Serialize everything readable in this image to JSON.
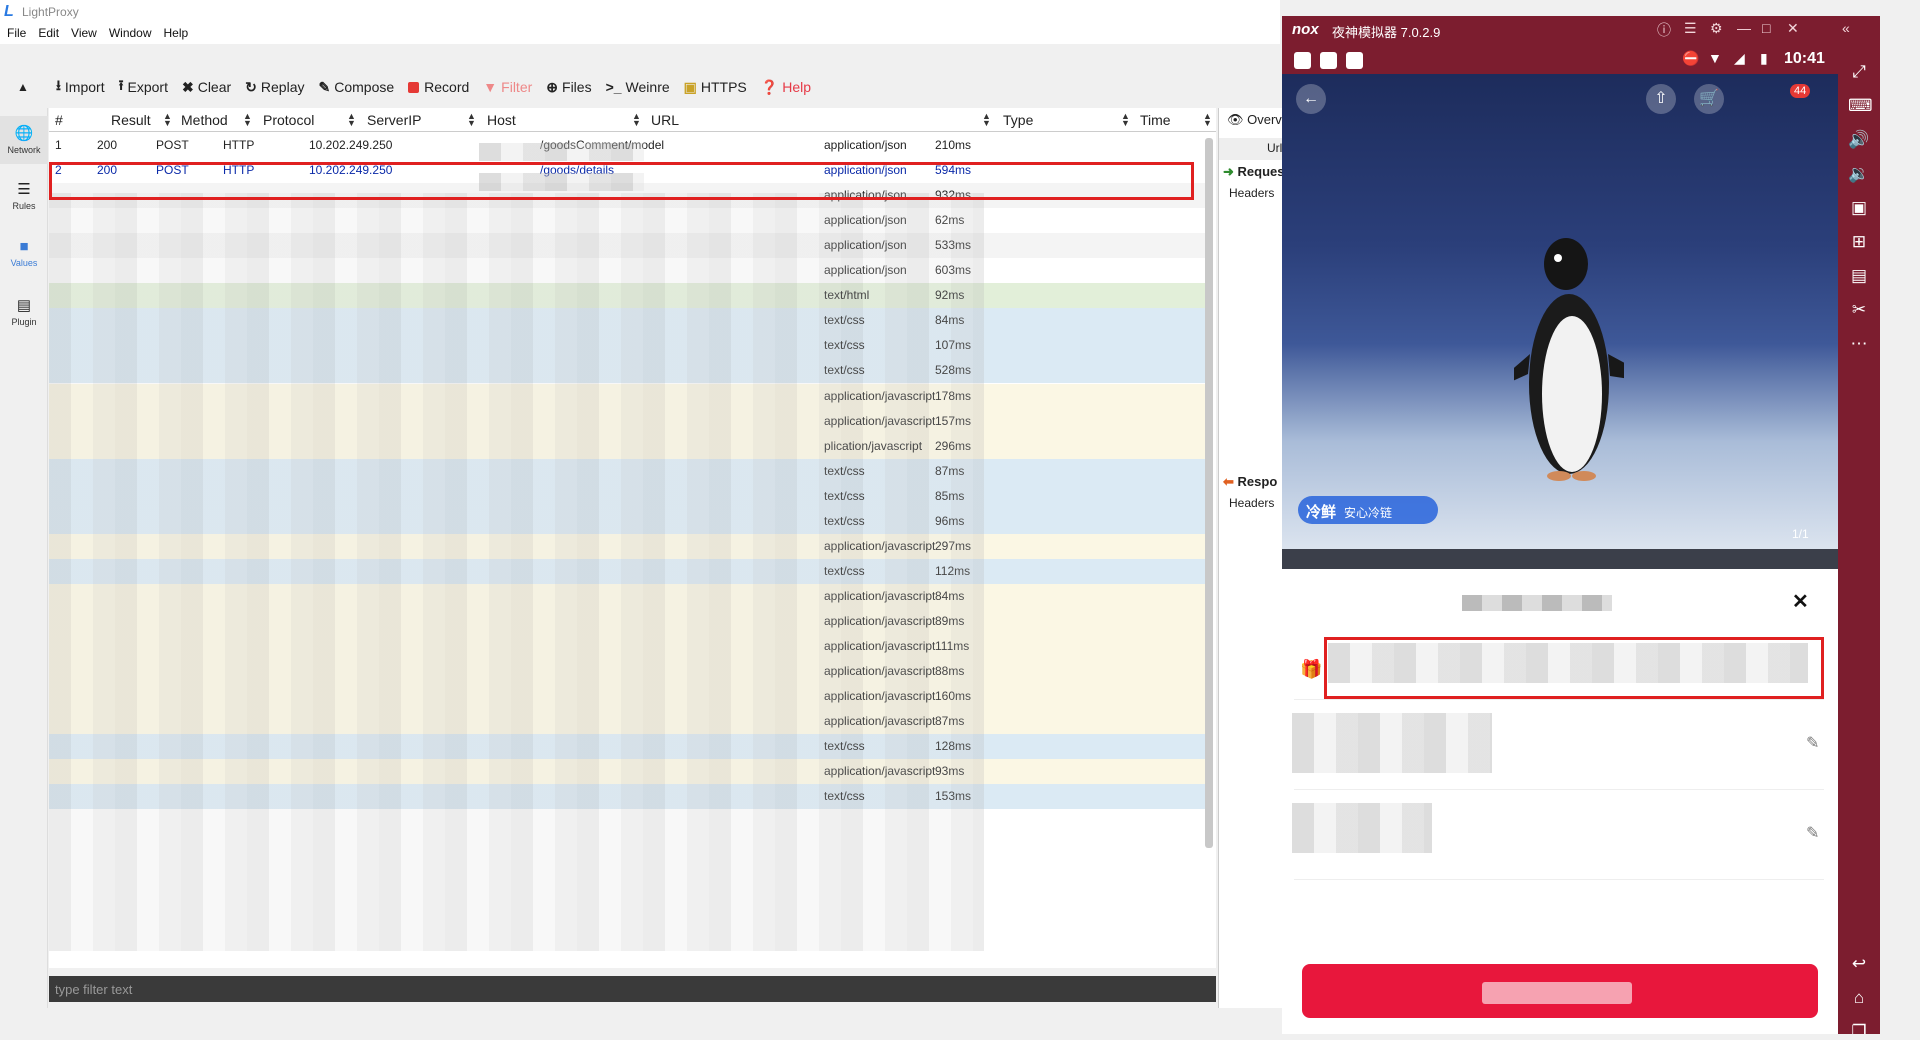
{
  "app": {
    "title": "LightProxy"
  },
  "menu": [
    "File",
    "Edit",
    "View",
    "Window",
    "Help"
  ],
  "toolbar": {
    "import": "Import",
    "export": "Export",
    "clear": "Clear",
    "replay": "Replay",
    "compose": "Compose",
    "record": "Record",
    "filter": "Filter",
    "files": "Files",
    "weinre": "Weinre",
    "https": "HTTPS",
    "help": "Help"
  },
  "sidebar": {
    "network": "Network",
    "rules": "Rules",
    "values": "Values",
    "plugins": "Plugin"
  },
  "table": {
    "headers": {
      "num": "#",
      "result": "Result",
      "method": "Method",
      "protocol": "Protocol",
      "serverip": "ServerIP",
      "host": "Host",
      "url": "URL",
      "type": "Type",
      "time": "Time"
    },
    "rows": [
      {
        "num": "1",
        "result": "200",
        "method": "POST",
        "protocol": "HTTP",
        "ip": "10.202.249.250",
        "url": "/goodsComment/model",
        "type": "application/json",
        "time": "210ms",
        "kind": "json"
      },
      {
        "num": "2",
        "result": "200",
        "method": "POST",
        "protocol": "HTTP",
        "ip": "10.202.249.250",
        "url": "/goods/details",
        "type": "application/json",
        "time": "594ms",
        "kind": "json"
      },
      {
        "type": "application/json",
        "time": "932ms",
        "kind": "alt"
      },
      {
        "type": "application/json",
        "time": "62ms",
        "kind": "json"
      },
      {
        "type": "application/json",
        "time": "533ms",
        "kind": "alt"
      },
      {
        "type": "application/json",
        "time": "603ms",
        "kind": "json"
      },
      {
        "type": "text/html",
        "time": "92ms",
        "kind": "html"
      },
      {
        "type": "text/css",
        "time": "84ms",
        "kind": "css"
      },
      {
        "type": "text/css",
        "time": "107ms",
        "kind": "css"
      },
      {
        "type": "text/css",
        "time": "528ms",
        "kind": "css"
      },
      {
        "type": "application/javascript",
        "time": "178ms",
        "kind": "js"
      },
      {
        "type": "application/javascript",
        "time": "157ms",
        "kind": "js"
      },
      {
        "type": "plication/javascript",
        "time": "296ms",
        "kind": "js"
      },
      {
        "type": "text/css",
        "time": "87ms",
        "kind": "css"
      },
      {
        "type": "text/css",
        "time": "85ms",
        "kind": "css"
      },
      {
        "type": "text/css",
        "time": "96ms",
        "kind": "css"
      },
      {
        "type": "application/javascript",
        "time": "297ms",
        "kind": "js"
      },
      {
        "type": "text/css",
        "time": "112ms",
        "kind": "css"
      },
      {
        "type": "application/javascript",
        "time": "84ms",
        "kind": "js"
      },
      {
        "type": "application/javascript",
        "time": "89ms",
        "kind": "js"
      },
      {
        "type": "application/javascript",
        "time": "111ms",
        "kind": "js"
      },
      {
        "type": "application/javascript",
        "time": "88ms",
        "kind": "js"
      },
      {
        "type": "application/javascript",
        "time": "160ms",
        "kind": "js"
      },
      {
        "type": "application/javascript",
        "time": "87ms",
        "kind": "js"
      },
      {
        "type": "text/css",
        "time": "128ms",
        "kind": "css"
      },
      {
        "type": "application/javascript",
        "time": "93ms",
        "kind": "js"
      },
      {
        "type": "text/css",
        "time": "153ms",
        "kind": "css"
      }
    ]
  },
  "filter": {
    "placeholder": "type filter text"
  },
  "overview": {
    "tab": "Overv",
    "url": "Url",
    "request": "Reques",
    "request_headers": "Headers",
    "response": "Respo",
    "response_headers": "Headers"
  },
  "emulator": {
    "logo": "nox",
    "title": "夜神模拟器 7.0.2.9",
    "time": "10:41",
    "cart_badge": "44",
    "cold_tag_main": "冷鲜",
    "cold_tag_sub": "安心冷链",
    "image_counter": "1/1"
  },
  "colors": {
    "selection_border": "#e02020",
    "emulator_frame": "#7c1d2f",
    "confirm_button": "#e8173c"
  }
}
